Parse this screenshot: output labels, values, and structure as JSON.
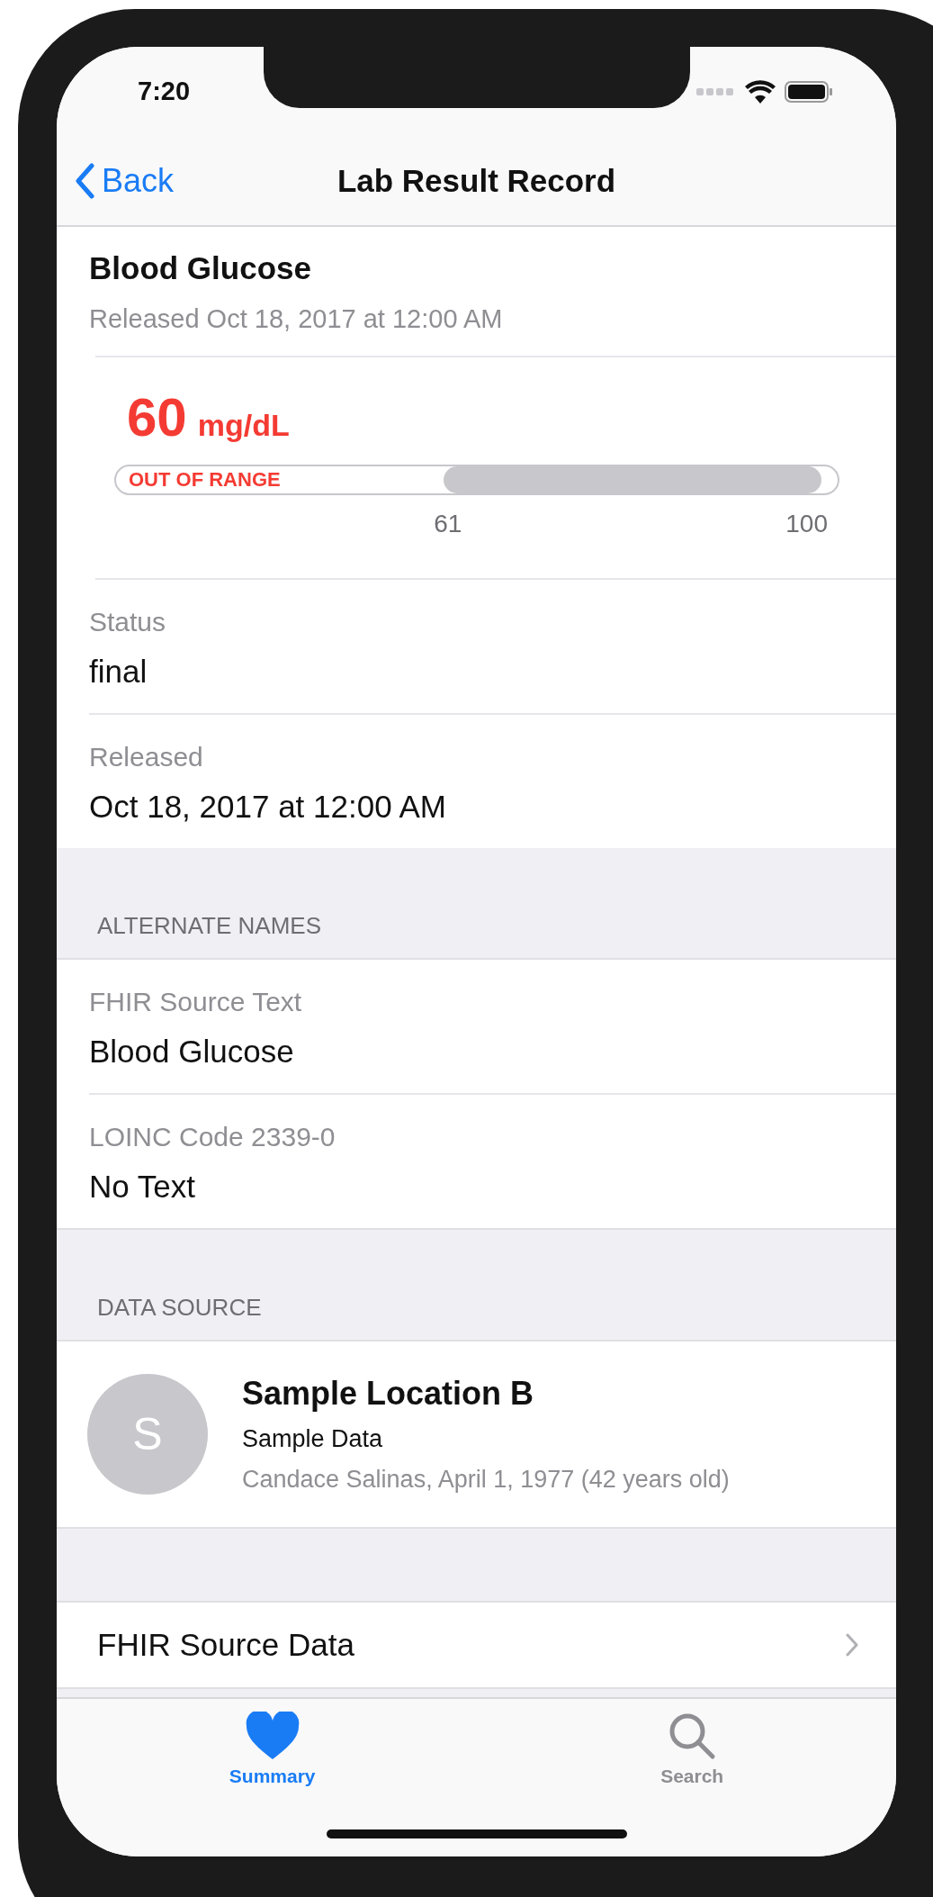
{
  "status_bar": {
    "time": "7:20"
  },
  "nav": {
    "back": "Back",
    "title": "Lab Result Record"
  },
  "result": {
    "name": "Blood Glucose",
    "released": "Released Oct 18, 2017 at 12:00 AM",
    "value": "60",
    "unit": "mg/dL",
    "out_of_range": true,
    "range_label": "OUT OF RANGE",
    "ticks": [
      "61",
      "100"
    ]
  },
  "fields": [
    {
      "label": "Status",
      "value": "final"
    },
    {
      "label": "Released",
      "value": "Oct 18, 2017 at 12:00 AM"
    }
  ],
  "alternate_names": {
    "header": "ALTERNATE NAMES",
    "items": [
      {
        "label": "FHIR Source Text",
        "value": "Blood Glucose"
      },
      {
        "label": "LOINC Code 2339-0",
        "value": "No Text"
      }
    ]
  },
  "data_source": {
    "header": "DATA SOURCE",
    "initial": "S",
    "name": "Sample Location B",
    "subtitle": "Sample Data",
    "patient": "Candace Salinas, April 1, 1977 (42 years old)"
  },
  "link_row": {
    "label": "FHIR Source Data"
  },
  "tabs": [
    {
      "label": "Summary",
      "selected": true,
      "kind": "heart"
    },
    {
      "label": "Search",
      "selected": false,
      "kind": "search"
    }
  ]
}
